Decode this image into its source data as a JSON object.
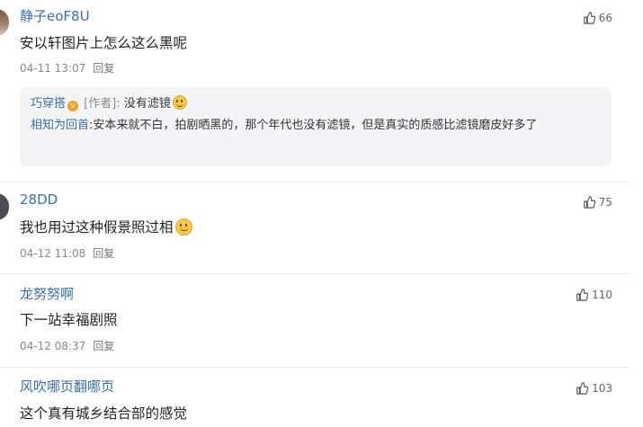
{
  "comments": [
    {
      "username": "静子eoF8U",
      "text": "安以轩图片上怎么这么黑呢",
      "time": "04-11 13:07",
      "reply_label": "回复",
      "likes": "66",
      "replies": [
        {
          "username": "巧穿搭",
          "badge": "v",
          "author_tag": "[作者]:",
          "text": "没有滤镜"
        },
        {
          "username": "相知为回首",
          "separator": ":",
          "text": "安本来就不白，拍剧晒黑的，那个年代也没有滤镜，但是真实的质感比滤镜磨皮好多了"
        }
      ]
    },
    {
      "username": "28DD",
      "text": "我也用过这种假景照过相",
      "time": "04-12 11:08",
      "reply_label": "回复",
      "likes": "75"
    },
    {
      "username": "龙努努啊",
      "text": "下一站幸福剧照",
      "time": "04-12 08:37",
      "reply_label": "回复",
      "likes": "110"
    },
    {
      "username": "风吹哪页翻哪页",
      "text": "这个真有城乡结合部的感觉",
      "likes": "103"
    }
  ],
  "icons": {
    "like": "thumbs-up-icon",
    "emoji": "smile-emoji-icon",
    "badge": "verified-badge-icon"
  },
  "colors": {
    "username": "#3a6ea5",
    "reply_background": "#f5f5f7",
    "meta": "#888888",
    "badge": "#f0a12a"
  }
}
